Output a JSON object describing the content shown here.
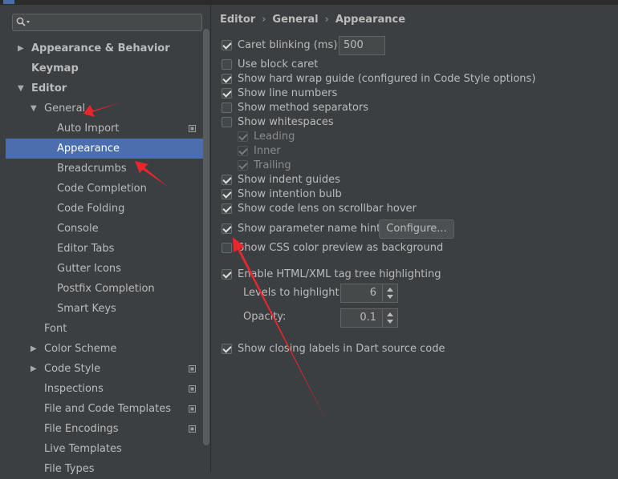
{
  "search": {
    "value": "",
    "placeholder": ""
  },
  "tree": [
    {
      "label": "Appearance & Behavior",
      "arrow": "▶",
      "bold": true
    },
    {
      "label": "Keymap",
      "bold": true
    },
    {
      "label": "Editor",
      "arrow": "▼",
      "bold": true
    },
    {
      "label": "General",
      "arrow": "▼"
    },
    {
      "label": "Auto Import",
      "project_icon": true
    },
    {
      "label": "Appearance",
      "selected": true
    },
    {
      "label": "Breadcrumbs"
    },
    {
      "label": "Code Completion"
    },
    {
      "label": "Code Folding"
    },
    {
      "label": "Console"
    },
    {
      "label": "Editor Tabs"
    },
    {
      "label": "Gutter Icons"
    },
    {
      "label": "Postfix Completion"
    },
    {
      "label": "Smart Keys"
    },
    {
      "label": "Font"
    },
    {
      "label": "Color Scheme",
      "arrow": "▶"
    },
    {
      "label": "Code Style",
      "arrow": "▶",
      "project_icon": true
    },
    {
      "label": "Inspections",
      "project_icon": true
    },
    {
      "label": "File and Code Templates",
      "project_icon": true
    },
    {
      "label": "File Encodings",
      "project_icon": true
    },
    {
      "label": "Live Templates"
    },
    {
      "label": "File Types"
    }
  ],
  "breadcrumb": [
    "Editor",
    "General",
    "Appearance"
  ],
  "options": {
    "caret_blinking": {
      "label": "Caret blinking (ms):",
      "checked": true,
      "value": "500"
    },
    "block_caret": {
      "label": "Use block caret",
      "checked": false
    },
    "hard_wrap": {
      "label": "Show hard wrap guide (configured in Code Style options)",
      "checked": true
    },
    "line_numbers": {
      "label": "Show line numbers",
      "checked": true
    },
    "method_separators": {
      "label": "Show method separators",
      "checked": false
    },
    "whitespaces": {
      "label": "Show whitespaces",
      "checked": false
    },
    "leading": {
      "label": "Leading",
      "checked": true,
      "disabled": true
    },
    "inner": {
      "label": "Inner",
      "checked": true,
      "disabled": true
    },
    "trailing": {
      "label": "Trailing",
      "checked": true,
      "disabled": true
    },
    "indent_guides": {
      "label": "Show indent guides",
      "checked": true
    },
    "intention_bulb": {
      "label": "Show intention bulb",
      "checked": true
    },
    "code_lens": {
      "label": "Show code lens on scrollbar hover",
      "checked": true
    },
    "param_hints": {
      "label": "Show parameter name hints",
      "checked": true,
      "button": "Configure..."
    },
    "css_color": {
      "label": "Show CSS color preview as background",
      "checked": false
    },
    "tag_tree": {
      "label": "Enable HTML/XML tag tree highlighting",
      "checked": true
    },
    "levels": {
      "label": "Levels to highlight:",
      "value": "6"
    },
    "opacity": {
      "label": "Opacity:",
      "value": "0.1"
    },
    "dart_labels": {
      "label": "Show closing labels in Dart source code",
      "checked": true
    }
  },
  "colors": {
    "accent": "#4b6eaf",
    "background": "#3c3f41",
    "annotation_arrow": "#e8262c"
  }
}
